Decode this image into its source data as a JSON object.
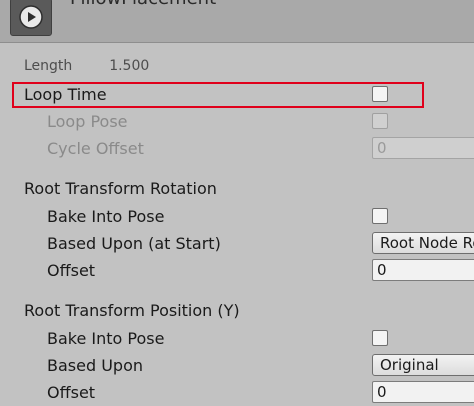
{
  "header": {
    "title": "PillowPlacement",
    "icon": "play-icon"
  },
  "length": {
    "label": "Length",
    "value": "1.500"
  },
  "loop_time": {
    "label": "Loop Time",
    "checked": false,
    "highlight_color": "#e0001b"
  },
  "loop_pose": {
    "label": "Loop Pose",
    "checked": false
  },
  "cycle_offset": {
    "label": "Cycle Offset",
    "value": "0"
  },
  "root_rotation": {
    "section_title": "Root Transform Rotation",
    "bake_label": "Bake Into Pose",
    "based_upon_label": "Based Upon (at Start)",
    "based_upon_value": "Root Node Rotation",
    "offset_label": "Offset",
    "offset_value": "0"
  },
  "root_position_y": {
    "section_title": "Root Transform Position (Y)",
    "bake_label": "Bake Into Pose",
    "based_upon_label": "Based Upon",
    "based_upon_value": "Original",
    "offset_label": "Offset",
    "offset_value": "0"
  }
}
